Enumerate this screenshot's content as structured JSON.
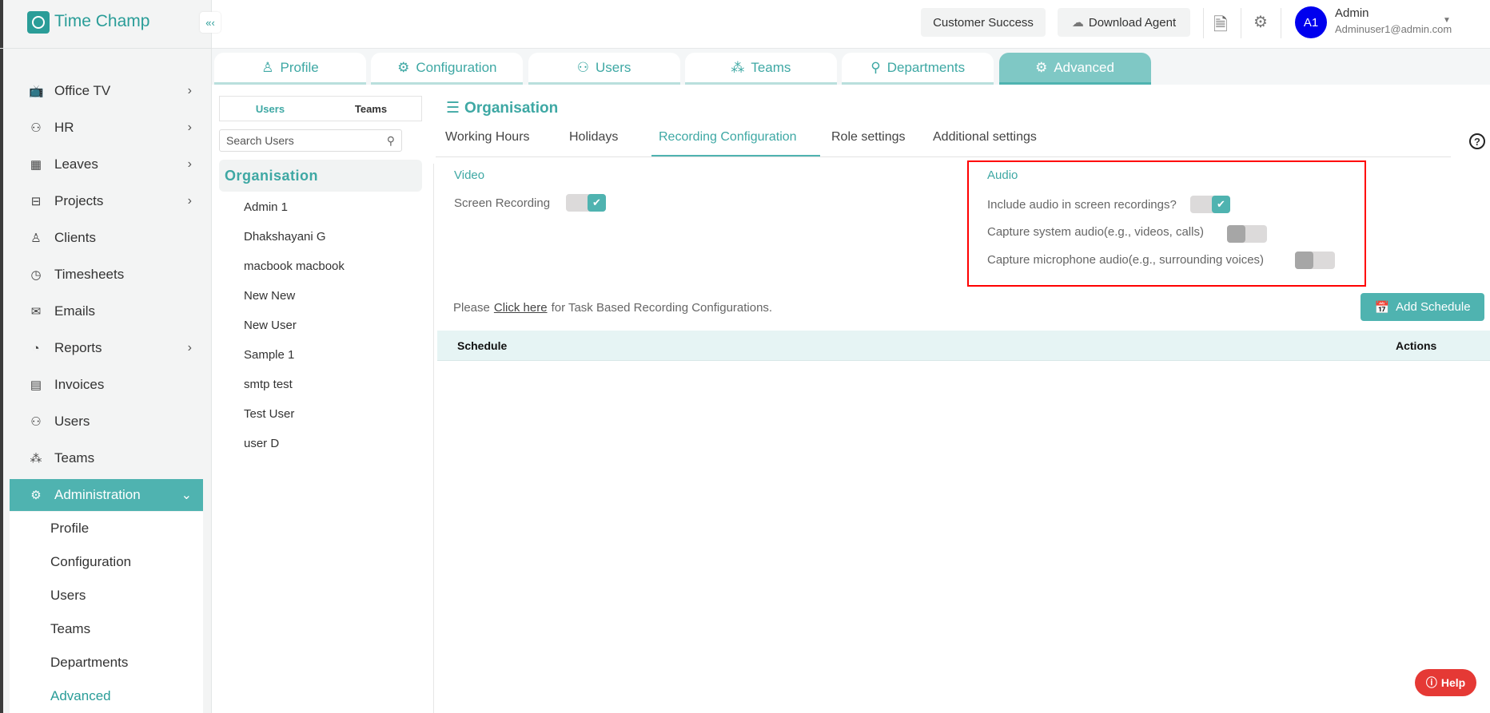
{
  "brand": "Time Champ",
  "header": {
    "customer_success": "Customer Success",
    "download_agent": "Download Agent",
    "user_initials": "A1",
    "user_name": "Admin",
    "user_email": "Adminuser1@admin.com"
  },
  "sidebar": {
    "items": [
      {
        "label": "Office TV",
        "icon": "tv-icon",
        "chevron": true
      },
      {
        "label": "HR",
        "icon": "person-icon",
        "chevron": true
      },
      {
        "label": "Leaves",
        "icon": "calendar-icon",
        "chevron": true
      },
      {
        "label": "Projects",
        "icon": "briefcase-icon",
        "chevron": true
      },
      {
        "label": "Clients",
        "icon": "client-icon",
        "chevron": false
      },
      {
        "label": "Timesheets",
        "icon": "clock-icon",
        "chevron": false
      },
      {
        "label": "Emails",
        "icon": "mail-icon",
        "chevron": false
      },
      {
        "label": "Reports",
        "icon": "pie-chart-icon",
        "chevron": true
      },
      {
        "label": "Invoices",
        "icon": "invoice-icon",
        "chevron": false
      },
      {
        "label": "Users",
        "icon": "users-icon",
        "chevron": false
      },
      {
        "label": "Teams",
        "icon": "teams-icon",
        "chevron": false
      }
    ],
    "admin": "Administration",
    "sub": [
      "Profile",
      "Configuration",
      "Users",
      "Teams",
      "Departments",
      "Advanced"
    ]
  },
  "tabs": [
    "Profile",
    "Configuration",
    "Users",
    "Teams",
    "Departments",
    "Advanced"
  ],
  "left": {
    "seg_users": "Users",
    "seg_teams": "Teams",
    "search_placeholder": "Search Users",
    "org": "Organisation",
    "users": [
      "Admin 1",
      "Dhakshayani G",
      "macbook macbook",
      "New New",
      "New User",
      "Sample 1",
      "smtp test",
      "Test User",
      "user D"
    ]
  },
  "main": {
    "title": "Organisation",
    "subtabs": [
      "Working Hours",
      "Holidays",
      "Recording Configuration",
      "Role settings",
      "Additional settings"
    ],
    "video": {
      "title": "Video",
      "screen_recording": "Screen Recording",
      "screen_recording_on": true
    },
    "audio": {
      "title": "Audio",
      "include": "Include audio in screen recordings?",
      "include_on": true,
      "system": "Capture system audio(e.g., videos, calls)",
      "system_on": false,
      "mic": "Capture microphone audio(e.g., surrounding voices)",
      "mic_on": false
    },
    "note_prefix": "Please",
    "note_link": "Click here",
    "note_suffix": "for Task Based Recording Configurations.",
    "add_schedule": "Add Schedule",
    "table": {
      "col_schedule": "Schedule",
      "col_actions": "Actions"
    }
  },
  "help": "Help",
  "colors": {
    "accent": "#4fb3b0",
    "highlight_box": "#ff0000",
    "help": "#e53935"
  }
}
